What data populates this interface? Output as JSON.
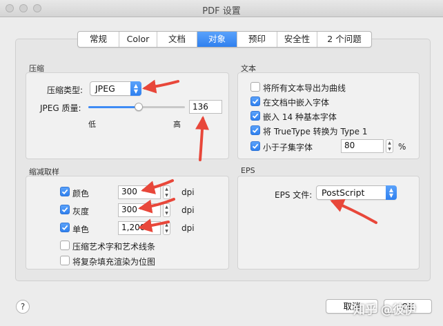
{
  "window": {
    "title": "PDF 设置"
  },
  "tabs": [
    {
      "label": "常规"
    },
    {
      "label": "Color"
    },
    {
      "label": "文档"
    },
    {
      "label": "对象",
      "active": true
    },
    {
      "label": "预印"
    },
    {
      "label": "安全性"
    },
    {
      "label": "2 个问题"
    }
  ],
  "compression": {
    "group_title": "压缩",
    "type_label": "压缩类型:",
    "type_value": "JPEG",
    "quality_label": "JPEG 质量:",
    "quality_value": "136",
    "slider_low": "低",
    "slider_high": "高",
    "slider_fraction": 0.52
  },
  "downsample": {
    "group_title": "缩减取样",
    "rows": [
      {
        "label": "颜色",
        "checked": true,
        "value": "300",
        "unit": "dpi"
      },
      {
        "label": "灰度",
        "checked": true,
        "value": "300",
        "unit": "dpi"
      },
      {
        "label": "单色",
        "checked": true,
        "value": "1,200",
        "unit": "dpi"
      }
    ],
    "options": [
      {
        "label": "压缩艺术字和艺术线条",
        "checked": false
      },
      {
        "label": "将复杂填充渲染为位图",
        "checked": false
      }
    ]
  },
  "text": {
    "group_title": "文本",
    "options": [
      {
        "label": "将所有文本导出为曲线",
        "checked": false
      },
      {
        "label": "在文档中嵌入字体",
        "checked": true
      },
      {
        "label": "嵌入 14 种基本字体",
        "checked": true
      },
      {
        "label": "将 TrueType 转换为 Type 1",
        "checked": true
      },
      {
        "label": "小于子集字体",
        "checked": true
      }
    ],
    "subset_value": "80",
    "subset_unit": "%"
  },
  "eps": {
    "group_title": "EPS",
    "file_label": "EPS 文件:",
    "file_value": "PostScript"
  },
  "footer": {
    "help": "?",
    "cancel": "取消",
    "ok": "OK"
  },
  "watermark": "知乎 @彼伊",
  "colors": {
    "accent": "#3b87f5",
    "annotation_arrow": "#e8473a",
    "background": "#ececec"
  }
}
